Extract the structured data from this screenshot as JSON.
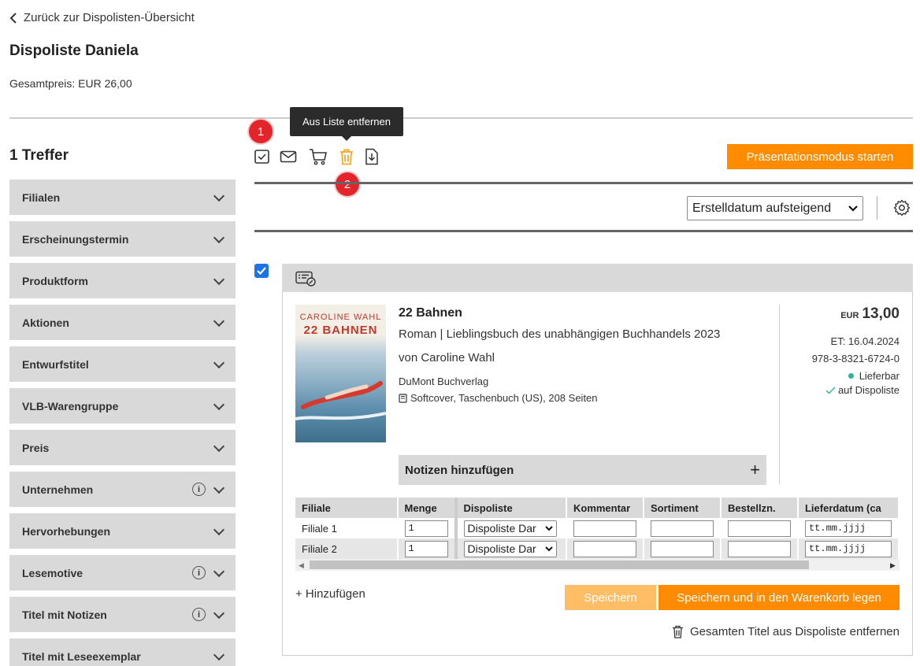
{
  "header": {
    "back_link": "Zurück zur Dispolisten-Übersicht",
    "title": "Dispoliste Daniela",
    "total": "Gesamtpreis: EUR 26,00"
  },
  "sidebar": {
    "hits": "1 Treffer",
    "facets": [
      {
        "label": "Filialen",
        "info": false
      },
      {
        "label": "Erscheinungstermin",
        "info": false
      },
      {
        "label": "Produktform",
        "info": false
      },
      {
        "label": "Aktionen",
        "info": false
      },
      {
        "label": "Entwurfstitel",
        "info": false
      },
      {
        "label": "VLB-Warengruppe",
        "info": false
      },
      {
        "label": "Preis",
        "info": false
      },
      {
        "label": "Unternehmen",
        "info": true
      },
      {
        "label": "Hervorhebungen",
        "info": false
      },
      {
        "label": "Lesemotive",
        "info": true
      },
      {
        "label": "Titel mit Notizen",
        "info": true
      },
      {
        "label": "Titel mit Leseexemplar",
        "info": false
      }
    ],
    "info_glyph": "i"
  },
  "toolbar": {
    "tooltip": "Aus Liste entfernen",
    "badge1": "1",
    "badge2": "2",
    "present_button": "Präsentationsmodus starten",
    "sort_value": "Erstelldatum aufsteigend",
    "icons": [
      "select-all-icon",
      "mail-icon",
      "cart-icon",
      "trash-icon",
      "download-icon",
      "settings-gear-icon"
    ]
  },
  "colors": {
    "accent": "#ff8c00",
    "accent_light": "#ffbd66",
    "badge": "#e3242b",
    "trash_active": "#f5a623",
    "available": "#2bb39b"
  },
  "product": {
    "cover_author": "CAROLINE WAHL",
    "cover_title": "22 BAHNEN",
    "title": "22 Bahnen",
    "subtitle": "Roman | Lieblingsbuch des unabhängigen Buchhandels 2023",
    "author": "von Caroline Wahl",
    "publisher": "DuMont Buchverlag",
    "format": "Softcover, Taschenbuch (US), 208 Seiten",
    "currency": "EUR",
    "price": "13,00",
    "release": "ET: 16.04.2024",
    "isbn": "978-3-8321-6724-0",
    "availability": "Lieferbar",
    "on_list": "auf Dispoliste",
    "notes_label": "Notizen hinzufügen",
    "notes_plus": "+"
  },
  "table": {
    "headers": [
      "Filiale",
      "Menge",
      "Dispoliste",
      "Kommentar",
      "Sortiment",
      "Bestellzn.",
      "Lieferdatum (ca"
    ],
    "rows": [
      {
        "filiale": "Filiale 1",
        "menge": "1",
        "dispoliste": "Dispoliste Dar",
        "lieferdatum": "tt.mm.jjjj"
      },
      {
        "filiale": "Filiale 2",
        "menge": "1",
        "dispoliste": "Dispoliste Dar",
        "lieferdatum": "tt.mm.jjjj"
      }
    ]
  },
  "actions": {
    "add": "+ Hinzufügen",
    "save": "Speichern",
    "save_cart": "Speichern und in den Warenkorb legen",
    "remove_title": "Gesamten Titel aus Dispoliste entfernen"
  }
}
